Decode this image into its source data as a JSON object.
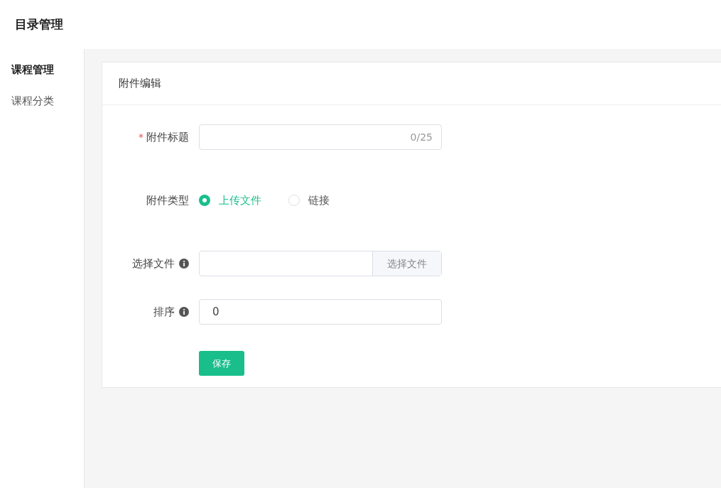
{
  "header": {
    "title": "目录管理"
  },
  "sidebar": {
    "items": [
      {
        "label": "课程管理",
        "selected": true
      },
      {
        "label": "课程分类",
        "selected": false
      }
    ]
  },
  "card": {
    "title": "附件编辑"
  },
  "form": {
    "fields": [
      {
        "kind": "text",
        "label": "附件标题",
        "required_mark": "*",
        "info": false,
        "counter": "0/25"
      },
      {
        "kind": "radio",
        "label": "附件类型",
        "info": false,
        "options": [
          {
            "label": "上传文件",
            "selected": true
          },
          {
            "label": "链接",
            "selected": false
          }
        ]
      },
      {
        "kind": "file",
        "label": "选择文件",
        "info": true,
        "button": "选择文件"
      },
      {
        "kind": "number",
        "label": "排序",
        "info": true,
        "value": "0"
      }
    ],
    "submit": "保存"
  }
}
